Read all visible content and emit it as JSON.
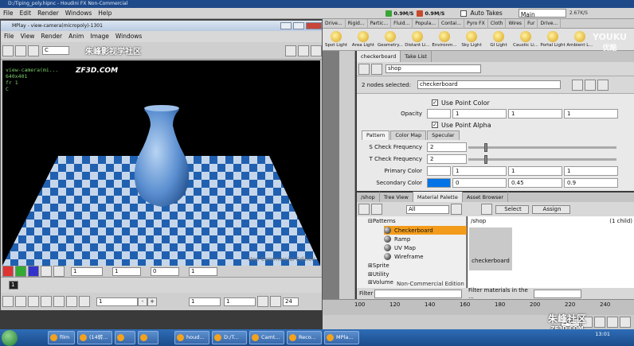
{
  "host": {
    "title": "D:/Tiping_poly.hipnc - Houdini FX Non-Commercial",
    "menu": [
      "File",
      "Edit",
      "Render",
      "Windows",
      "Help"
    ],
    "net_down": "0.9M/S",
    "net_up": "0.9M/S",
    "auto_takes": "Auto Takes",
    "desktop": "Main",
    "net_speed": "2.67K/S"
  },
  "shelf": {
    "tabs": [
      "Drive...",
      "Rigid...",
      "Partic...",
      "Fluid...",
      "Popula...",
      "Contai...",
      "Pyro FX",
      "Cloth",
      "Wires",
      "Fur",
      "Drive..."
    ],
    "tools": [
      "Spot Light",
      "Area Light",
      "Geometry...",
      "Distant Li...",
      "Environm...",
      "Sky Light",
      "GI Light",
      "Caustic Li...",
      "Portal Light",
      "Ambient L..."
    ]
  },
  "mplay": {
    "title": "MPlay - view-camera(micropoly)-1301",
    "menu": [
      "File",
      "View",
      "Render",
      "Anim",
      "Image",
      "Windows"
    ],
    "channel": "C",
    "overlay_lines": [
      "view-camera(mi...",
      "640x401",
      "fr 1",
      "C"
    ],
    "watermark_cn": "朱峰影视学社区",
    "watermark_site": "ZF3D.COM",
    "nc_label": "Non-Commercial Edition",
    "ctrl_value1": "1",
    "ctrl_value2": "1",
    "ctrl_value3": "0",
    "ctrl_value4": "1",
    "frame": "1",
    "start": "1",
    "end": "1",
    "range_end": "24"
  },
  "params": {
    "tabs": [
      "checkerboard",
      "Take List"
    ],
    "path": "shop",
    "nodes_selected_label": "2 nodes selected:",
    "node_name": "checkerboard",
    "use_point_color": "Use Point Color",
    "opacity_label": "Opacity",
    "opacity": [
      "1",
      "1",
      "1"
    ],
    "use_point_alpha": "Use Point Alpha",
    "subtabs": [
      "Pattern",
      "Color Map",
      "Specular"
    ],
    "s_check_label": "S Check Frequency",
    "s_check": "2",
    "t_check_label": "T Check Frequency",
    "t_check": "2",
    "primary_label": "Primary Color",
    "primary": [
      "1",
      "1",
      "1"
    ],
    "secondary_label": "Secondary Color",
    "secondary": [
      "0",
      "0.45",
      "0.9"
    ],
    "primary_color": "#ffffff",
    "secondary_color": "#0073e6"
  },
  "material": {
    "tabs": [
      "/shop",
      "Tree View",
      "Material Palette",
      "Asset Browser"
    ],
    "filter_value": "All",
    "select_label": "Select",
    "assign_label": "Assign",
    "tree": {
      "patterns": "Patterns",
      "items": [
        "Checkerboard",
        "Ramp",
        "UV Map",
        "Wireframe"
      ],
      "sprite": "Sprite",
      "utility": "Utility",
      "volume": "Volume"
    },
    "shop_path": "/shop",
    "child_count": "(1 child)",
    "thumb_label": "checkerboard",
    "nc_label": "Non-Commercial Edition",
    "filter_label": "Filter",
    "filter_materials": "Filter materials in the ..."
  },
  "timeline": {
    "ticks": [
      "100",
      "120",
      "140",
      "160",
      "180",
      "200",
      "220",
      "240"
    ],
    "end_frame": "240"
  },
  "taskbar": {
    "items": [
      "film",
      "(14转...",
      "",
      "",
      "houd...",
      "D:/T...",
      "Camt...",
      "Reco...",
      "MPla..."
    ],
    "time": "13:01"
  },
  "watermarks": {
    "youku": "YOUKU",
    "youku_cn": "优酷",
    "site_cn": "朱峰社区",
    "site": "ZF3D.COM"
  }
}
